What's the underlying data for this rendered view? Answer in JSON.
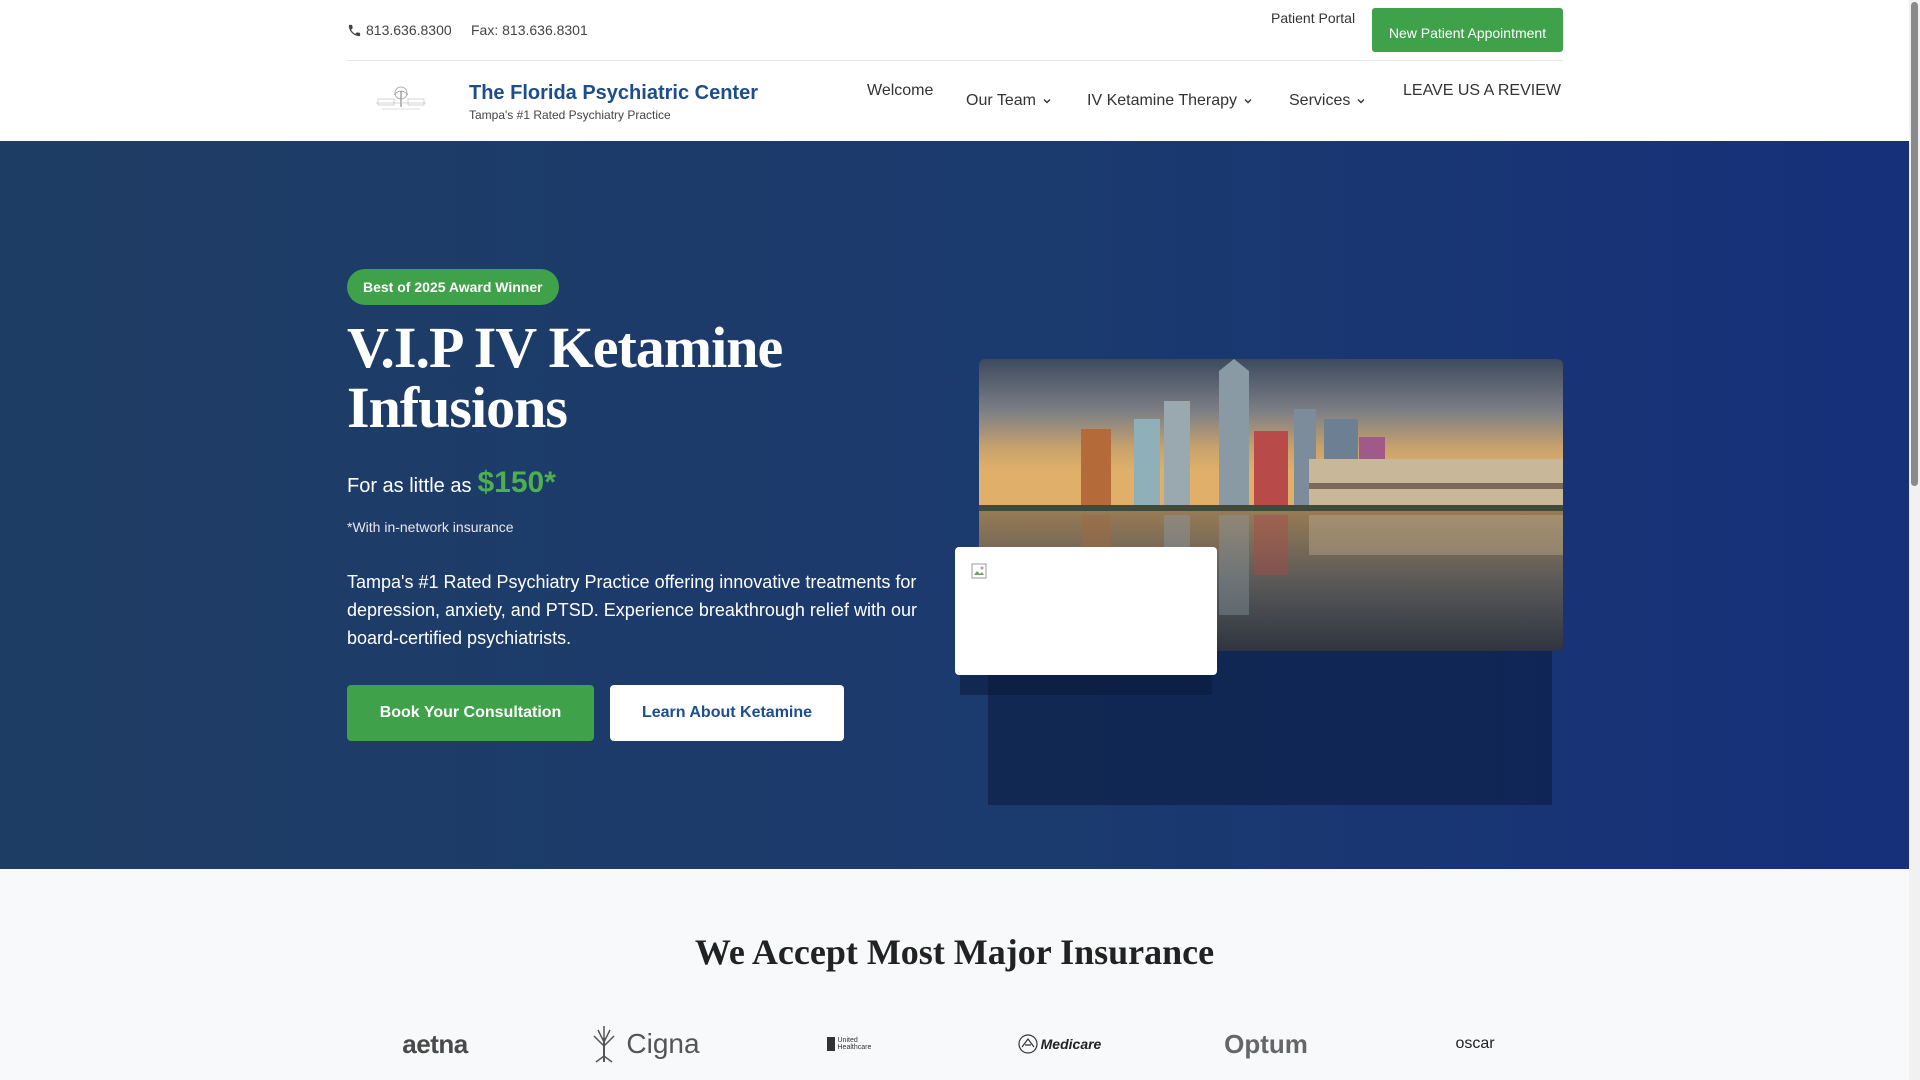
{
  "topbar": {
    "phone": "813.636.8300",
    "fax": "Fax: 813.636.8301",
    "patient_portal": "Patient Portal",
    "new_appointment": "New Patient Appointment"
  },
  "brand": {
    "name": "The Florida Psychiatric Center",
    "tagline": "Tampa's #1 Rated Psychiatry Practice"
  },
  "nav": {
    "welcome": "Welcome",
    "our_team": "Our Team",
    "iv_ketamine": "IV Ketamine Therapy",
    "services": "Services",
    "review": "LEAVE US A REVIEW"
  },
  "hero": {
    "badge": "Best of 2025 Award Winner",
    "title": "V.I.P IV Ketamine Infusions",
    "price_prefix": "For as little as",
    "price": "$150*",
    "price_note": "*With in-network insurance",
    "description": "Tampa's #1 Rated Psychiatry Practice offering innovative treatments for depression, anxiety, and PTSD. Experience breakthrough relief with our board-certified psychiatrists.",
    "book_button": "Book Your Consultation",
    "learn_button": "Learn About Ketamine"
  },
  "insurance": {
    "title": "We Accept Most Major Insurance",
    "logos": [
      "aetna",
      "Cigna",
      "United Healthcare",
      "Medicare",
      "Optum",
      "oscar"
    ]
  },
  "colors": {
    "brand_blue": "#1e4d8b",
    "accent_green": "#3fa14a",
    "hero_bg": "#1b3a6e"
  }
}
